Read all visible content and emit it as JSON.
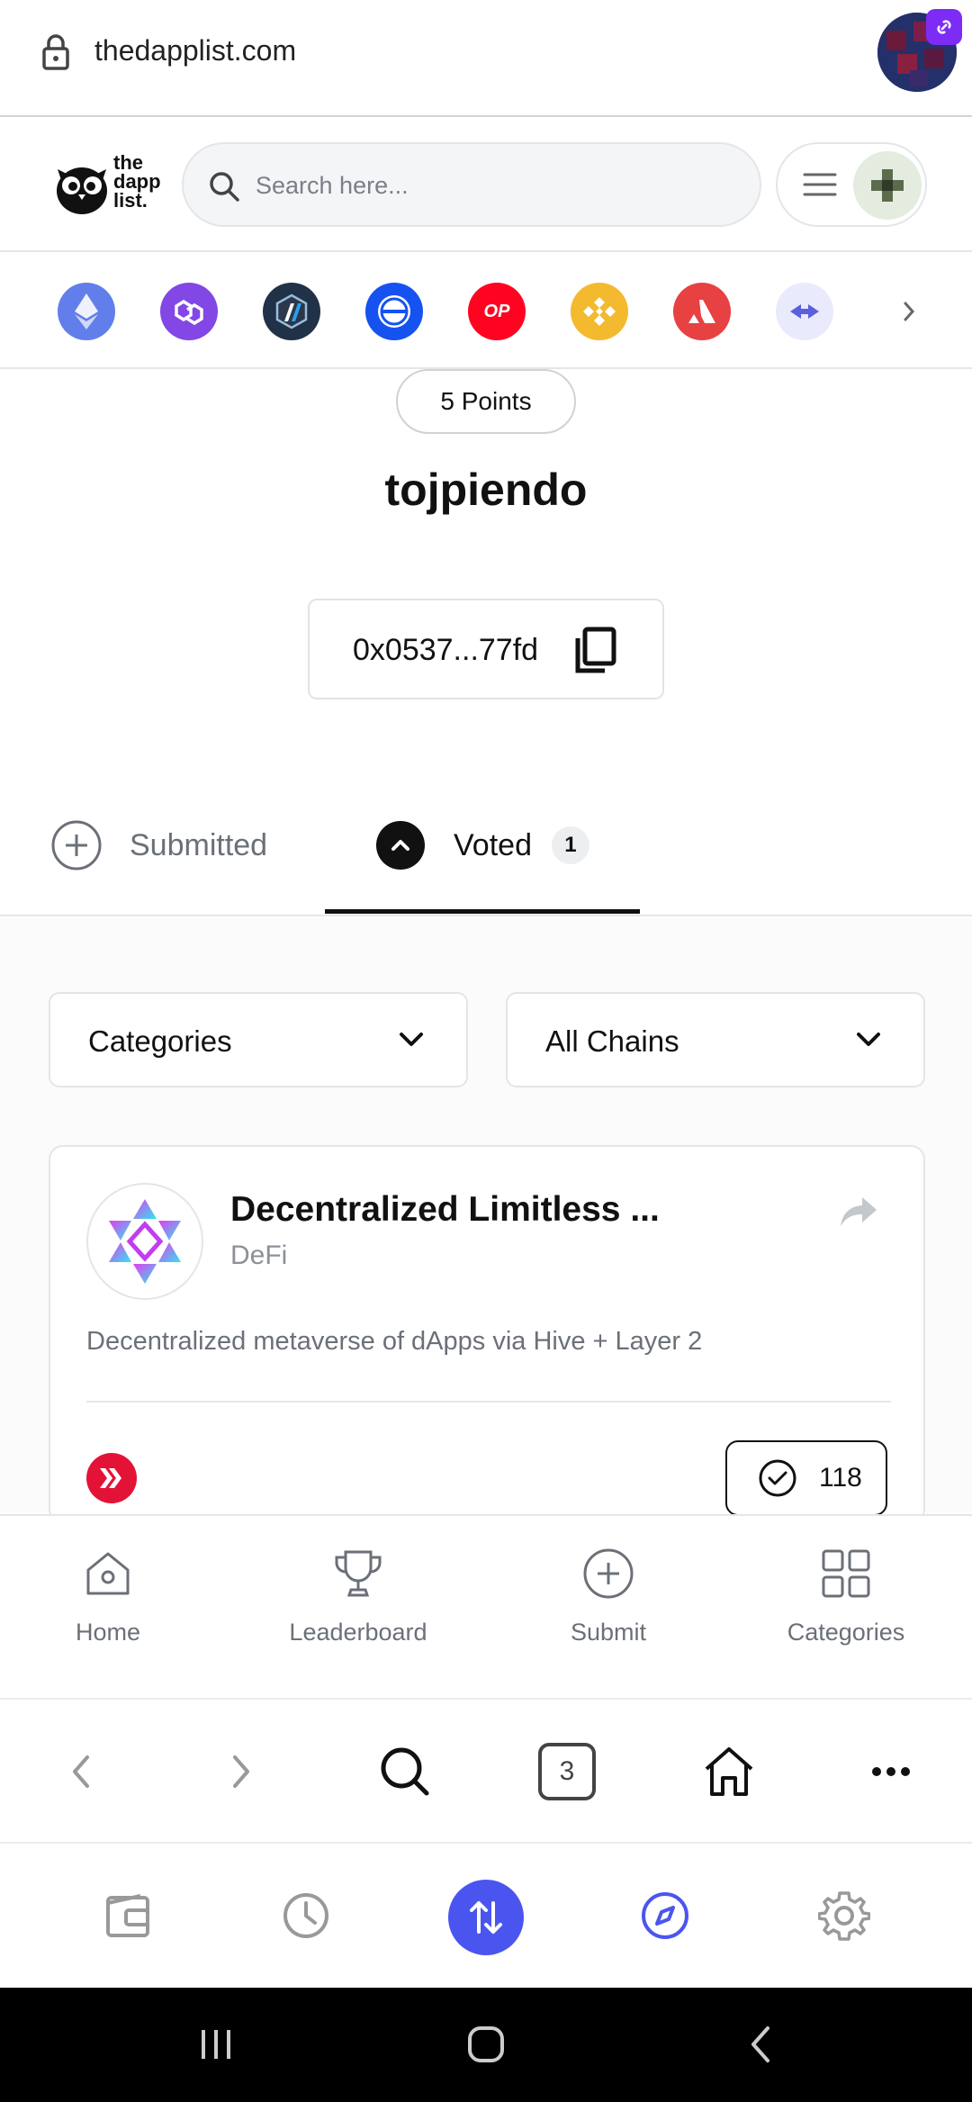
{
  "browser": {
    "url": "thedapplist.com",
    "tab_count": "3"
  },
  "site": {
    "logo_text": [
      "the",
      "dapp",
      "list."
    ],
    "search_placeholder": "Search here..."
  },
  "chains": [
    {
      "name": "ethereum-icon",
      "color": "#627eea"
    },
    {
      "name": "polygon-icon",
      "color": "#8247e5"
    },
    {
      "name": "arbitrum-icon",
      "color": "#213147"
    },
    {
      "name": "gnosis-icon",
      "color": "#1652f0"
    },
    {
      "name": "optimism-icon",
      "color": "#ff0420",
      "text": "OP"
    },
    {
      "name": "bnb-icon",
      "color": "#f3ba2f"
    },
    {
      "name": "avalanche-icon",
      "color": "#e84142"
    },
    {
      "name": "bridge-icon",
      "color": "#e9eafc"
    }
  ],
  "profile": {
    "points": "5 Points",
    "username": "tojpiendo",
    "address": "0x0537...77fd"
  },
  "tabs": {
    "submitted": "Submitted",
    "voted": "Voted",
    "voted_count": "1"
  },
  "filters": {
    "categories": "Categories",
    "chains": "All Chains"
  },
  "dapp_card": {
    "title": "Decentralized Limitless ...",
    "category": "DeFi",
    "description": "Decentralized metaverse of dApps via Hive + Layer 2",
    "votes": "118"
  },
  "site_nav": {
    "home": "Home",
    "leaderboard": "Leaderboard",
    "submit": "Submit",
    "categories": "Categories"
  },
  "colors": {
    "accent": "#4a55f0",
    "hive": "#e31337"
  }
}
